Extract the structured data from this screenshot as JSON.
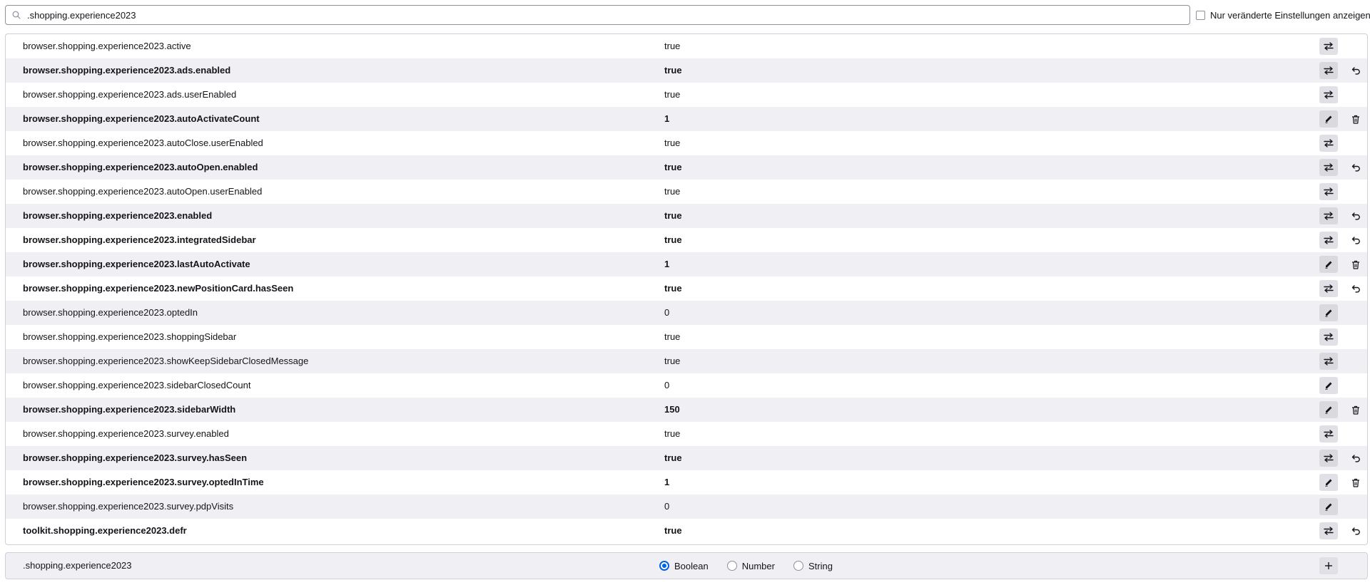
{
  "search": {
    "value": ".shopping.experience2023",
    "modified_only_label": "Nur veränderte Einstellungen anzeigen",
    "modified_only_checked": false
  },
  "prefs": [
    {
      "name": "browser.shopping.experience2023.active",
      "value": "true",
      "modified": false,
      "action": "toggle"
    },
    {
      "name": "browser.shopping.experience2023.ads.enabled",
      "value": "true",
      "modified": true,
      "action": "toggle",
      "secondary": "reset"
    },
    {
      "name": "browser.shopping.experience2023.ads.userEnabled",
      "value": "true",
      "modified": false,
      "action": "toggle"
    },
    {
      "name": "browser.shopping.experience2023.autoActivateCount",
      "value": "1",
      "modified": true,
      "action": "edit",
      "secondary": "delete"
    },
    {
      "name": "browser.shopping.experience2023.autoClose.userEnabled",
      "value": "true",
      "modified": false,
      "action": "toggle"
    },
    {
      "name": "browser.shopping.experience2023.autoOpen.enabled",
      "value": "true",
      "modified": true,
      "action": "toggle",
      "secondary": "reset"
    },
    {
      "name": "browser.shopping.experience2023.autoOpen.userEnabled",
      "value": "true",
      "modified": false,
      "action": "toggle"
    },
    {
      "name": "browser.shopping.experience2023.enabled",
      "value": "true",
      "modified": true,
      "action": "toggle",
      "secondary": "reset"
    },
    {
      "name": "browser.shopping.experience2023.integratedSidebar",
      "value": "true",
      "modified": true,
      "action": "toggle",
      "secondary": "reset"
    },
    {
      "name": "browser.shopping.experience2023.lastAutoActivate",
      "value": "1",
      "modified": true,
      "action": "edit",
      "secondary": "delete"
    },
    {
      "name": "browser.shopping.experience2023.newPositionCard.hasSeen",
      "value": "true",
      "modified": true,
      "action": "toggle",
      "secondary": "reset"
    },
    {
      "name": "browser.shopping.experience2023.optedIn",
      "value": "0",
      "modified": false,
      "action": "edit"
    },
    {
      "name": "browser.shopping.experience2023.shoppingSidebar",
      "value": "true",
      "modified": false,
      "action": "toggle"
    },
    {
      "name": "browser.shopping.experience2023.showKeepSidebarClosedMessage",
      "value": "true",
      "modified": false,
      "action": "toggle"
    },
    {
      "name": "browser.shopping.experience2023.sidebarClosedCount",
      "value": "0",
      "modified": false,
      "action": "edit"
    },
    {
      "name": "browser.shopping.experience2023.sidebarWidth",
      "value": "150",
      "modified": true,
      "action": "edit",
      "secondary": "delete"
    },
    {
      "name": "browser.shopping.experience2023.survey.enabled",
      "value": "true",
      "modified": false,
      "action": "toggle"
    },
    {
      "name": "browser.shopping.experience2023.survey.hasSeen",
      "value": "true",
      "modified": true,
      "action": "toggle",
      "secondary": "reset"
    },
    {
      "name": "browser.shopping.experience2023.survey.optedInTime",
      "value": "1",
      "modified": true,
      "action": "edit",
      "secondary": "delete"
    },
    {
      "name": "browser.shopping.experience2023.survey.pdpVisits",
      "value": "0",
      "modified": false,
      "action": "edit"
    },
    {
      "name": "toolkit.shopping.experience2023.defr",
      "value": "true",
      "modified": true,
      "action": "toggle",
      "secondary": "reset"
    }
  ],
  "add_row": {
    "name": ".shopping.experience2023",
    "types": [
      {
        "label": "Boolean",
        "checked": true
      },
      {
        "label": "Number",
        "checked": false
      },
      {
        "label": "String",
        "checked": false
      }
    ]
  },
  "colors": {
    "accent": "#0061e0",
    "row_alt": "#f0f0f4",
    "button_bg": "#e0e0e6",
    "border": "#cfcfd8"
  }
}
